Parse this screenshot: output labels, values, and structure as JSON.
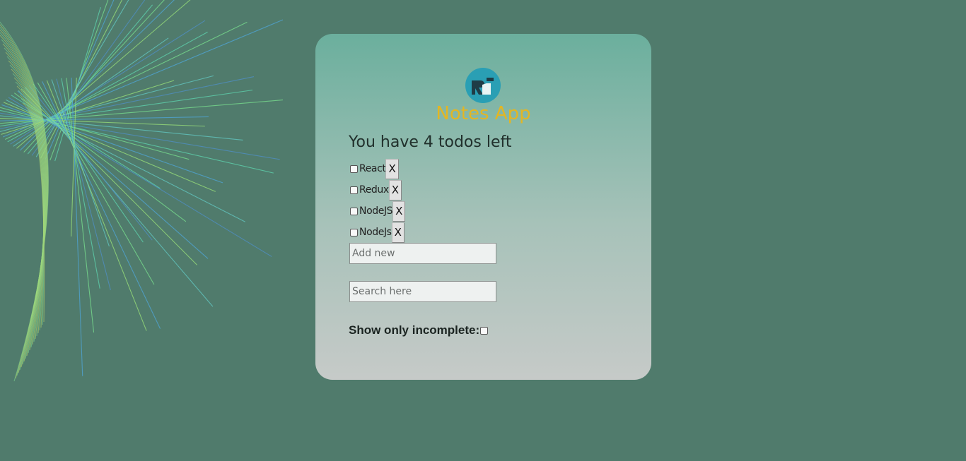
{
  "app": {
    "title": "Notes App",
    "logo_icon": "ri-logo-icon",
    "title_color": "#e3b623"
  },
  "summary": {
    "remaining_text": "You have 4 todos left"
  },
  "todos": [
    {
      "label": "React",
      "checked": false,
      "delete_label": "X"
    },
    {
      "label": "Redux",
      "checked": false,
      "delete_label": "X"
    },
    {
      "label": "NodeJS",
      "checked": false,
      "delete_label": "X"
    },
    {
      "label": "NodeJs",
      "checked": false,
      "delete_label": "X"
    }
  ],
  "add_input": {
    "placeholder": "Add new",
    "value": ""
  },
  "search_input": {
    "placeholder": "Search here",
    "value": ""
  },
  "filter": {
    "label": "Show only incomplete:",
    "checked": false
  },
  "colors": {
    "background": "#507b6c",
    "card_top": "#6baf9d",
    "card_bottom": "#c6cac8"
  }
}
